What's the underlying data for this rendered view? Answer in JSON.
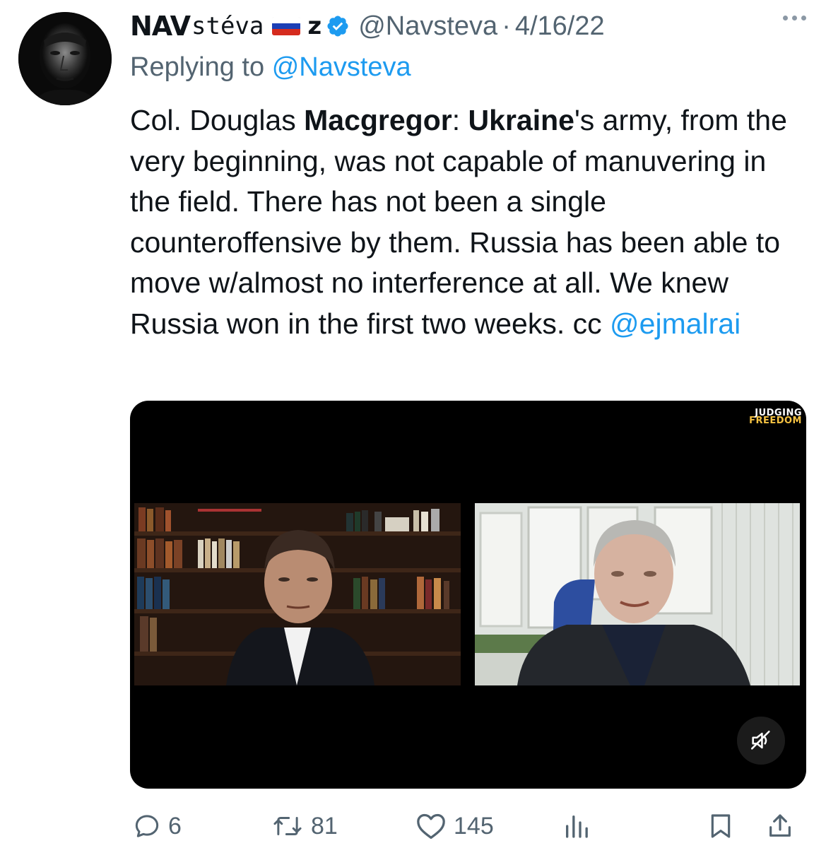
{
  "tweet": {
    "display_name_part1": "NAV",
    "display_name_part2": "stéva",
    "flag_colors": [
      "#ffffff",
      "#1c3fb5",
      "#d52b1e"
    ],
    "display_name_part3": "z",
    "handle": "@Navsteva",
    "separator": "·",
    "date": "4/16/22",
    "reply_prefix": "Replying to",
    "reply_to": "@Navsteva",
    "text": {
      "t1": "Col. Douglas ",
      "b1": "Macgregor",
      "t2": ": ",
      "b2": "Ukraine",
      "t3": "'s army, from the very beginning, was not capable of manuvering in the field. There has not been a single counteroffensive by them. Russia has been able to move w/almost no interference at all. We knew Russia won in the first two weeks. cc ",
      "mention": "@ejmalrai"
    },
    "media": {
      "brand_line1": "JUDGING",
      "brand_line2": "FREEDOM",
      "brand_colors": [
        "#ffffff",
        "#f5c242"
      ]
    },
    "actions": {
      "replies": "6",
      "retweets": "81",
      "likes": "145"
    },
    "icons": [
      "more-icon",
      "verified-badge-icon",
      "reply-icon",
      "retweet-icon",
      "like-icon",
      "views-icon",
      "bookmark-icon",
      "share-icon",
      "muted-speaker-icon"
    ],
    "accent": "#1d9bf0",
    "muted_text": "#536471"
  }
}
